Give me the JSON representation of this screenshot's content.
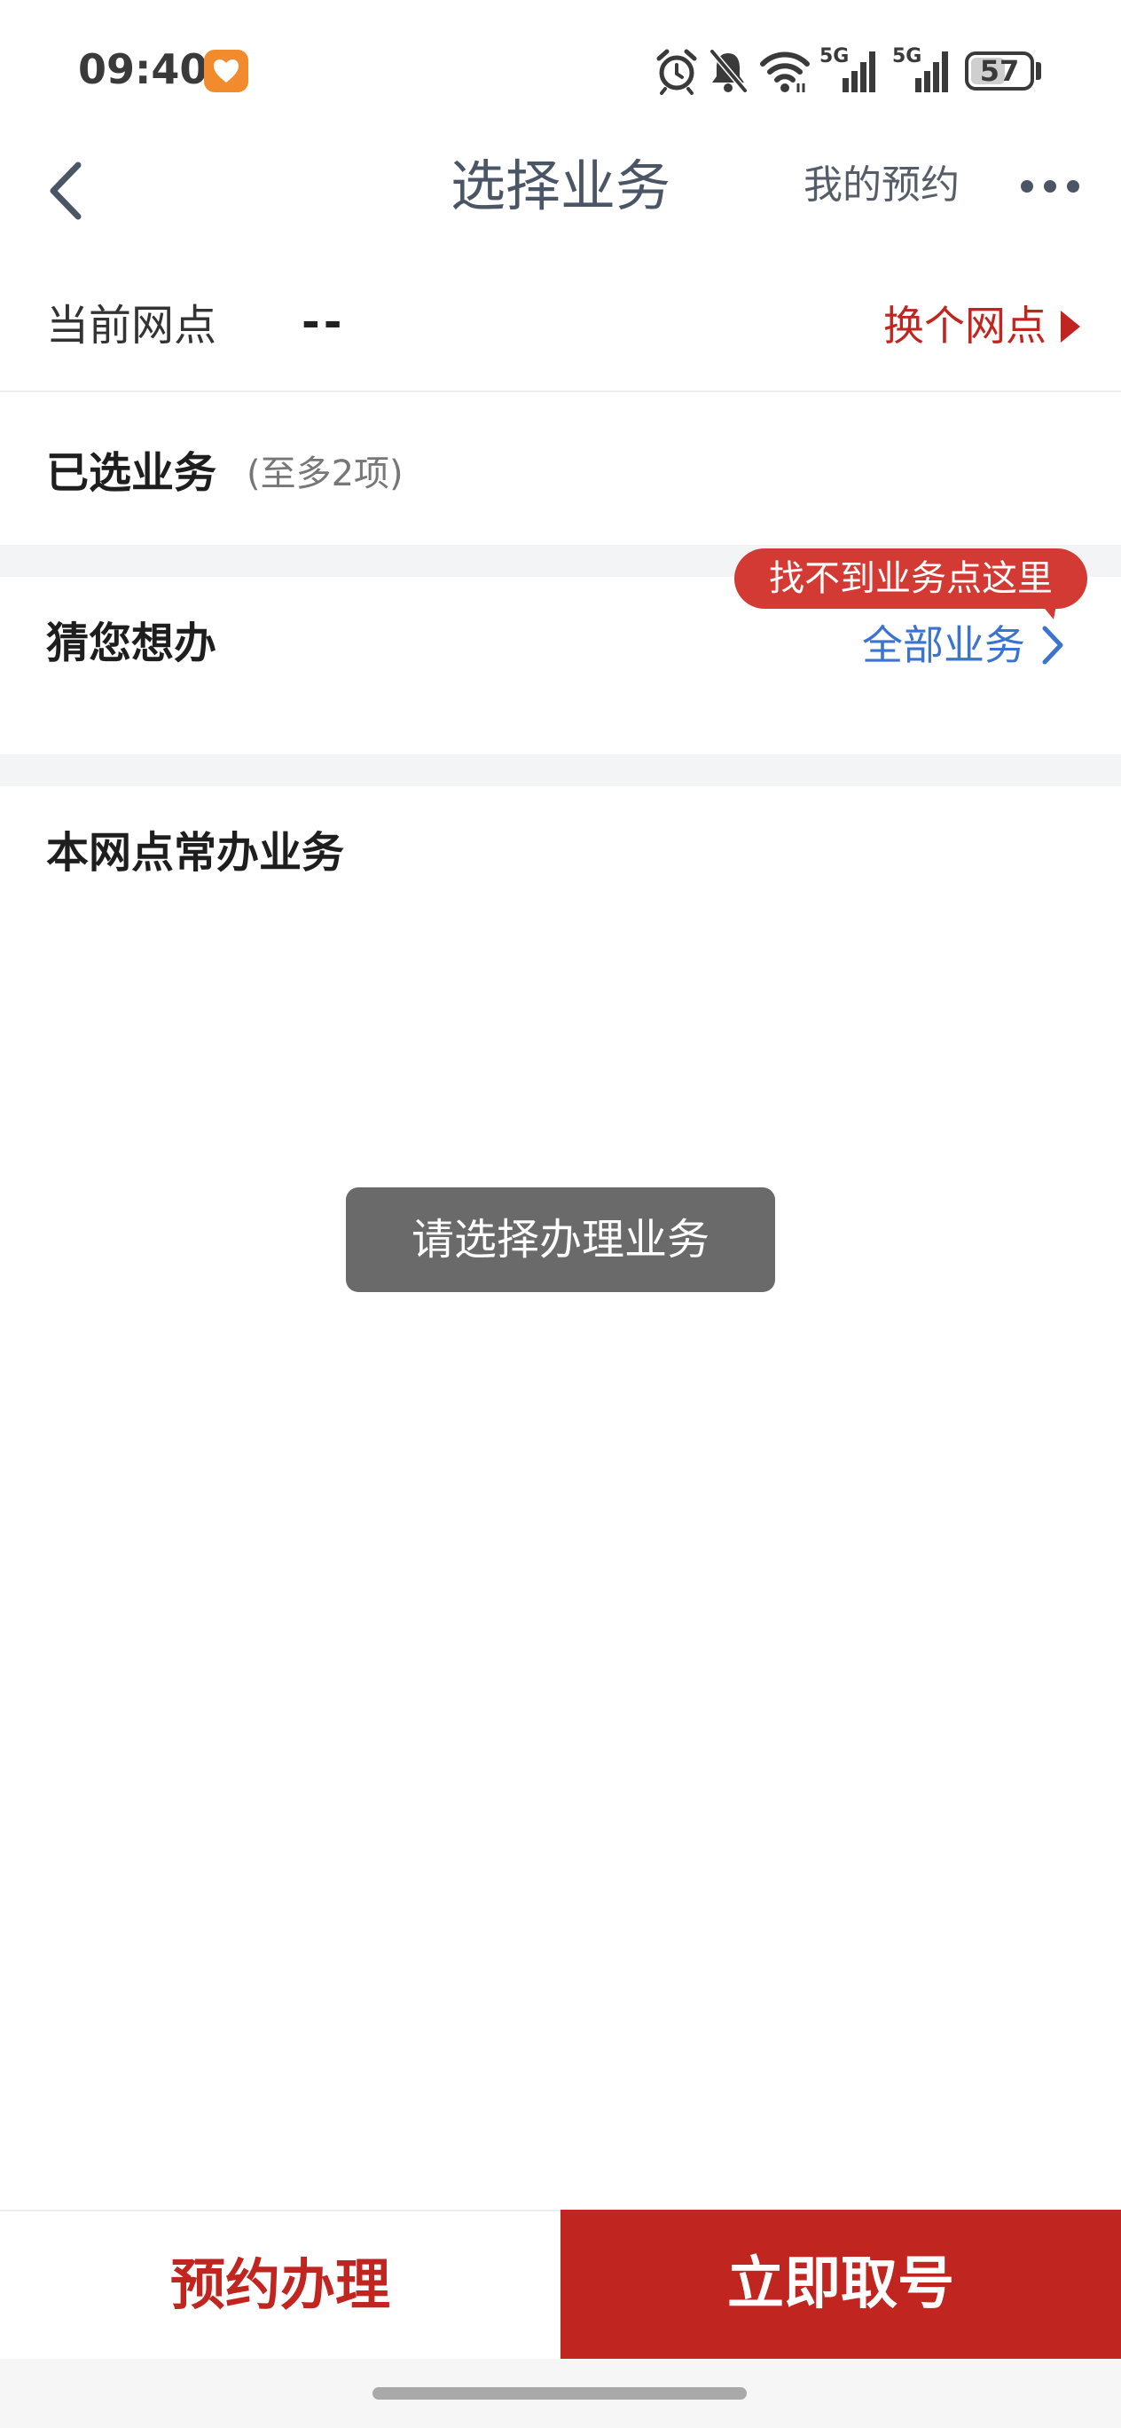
{
  "status_bar": {
    "time": "09:40",
    "battery": "57",
    "network_1": "5G",
    "network_2": "5G",
    "icons": [
      "health-app-icon",
      "alarm-icon",
      "bell-off-icon",
      "wifi-icon",
      "signal-icon",
      "signal-icon",
      "battery-icon"
    ]
  },
  "nav": {
    "title": "选择业务",
    "my_reservation": "我的预约",
    "back_icon": "chevron-left-icon",
    "more_icon": "more-dots-icon"
  },
  "branch": {
    "label": "当前网点",
    "value": "--",
    "change_label": "换个网点"
  },
  "selected": {
    "label": "已选业务",
    "note": "(至多2项)"
  },
  "guess": {
    "label": "猜您想办",
    "all_business": "全部业务",
    "tooltip": "找不到业务点这里"
  },
  "common": {
    "label": "本网点常办业务"
  },
  "toast": {
    "message": "请选择办理业务"
  },
  "bottom": {
    "reserve_label": "预约办理",
    "take_number_label": "立即取号"
  },
  "colors": {
    "accent_red": "#c1251f",
    "link_blue": "#3b73d1",
    "tooltip_red": "#d43a34",
    "toast_gray": "#6a6a6a"
  }
}
